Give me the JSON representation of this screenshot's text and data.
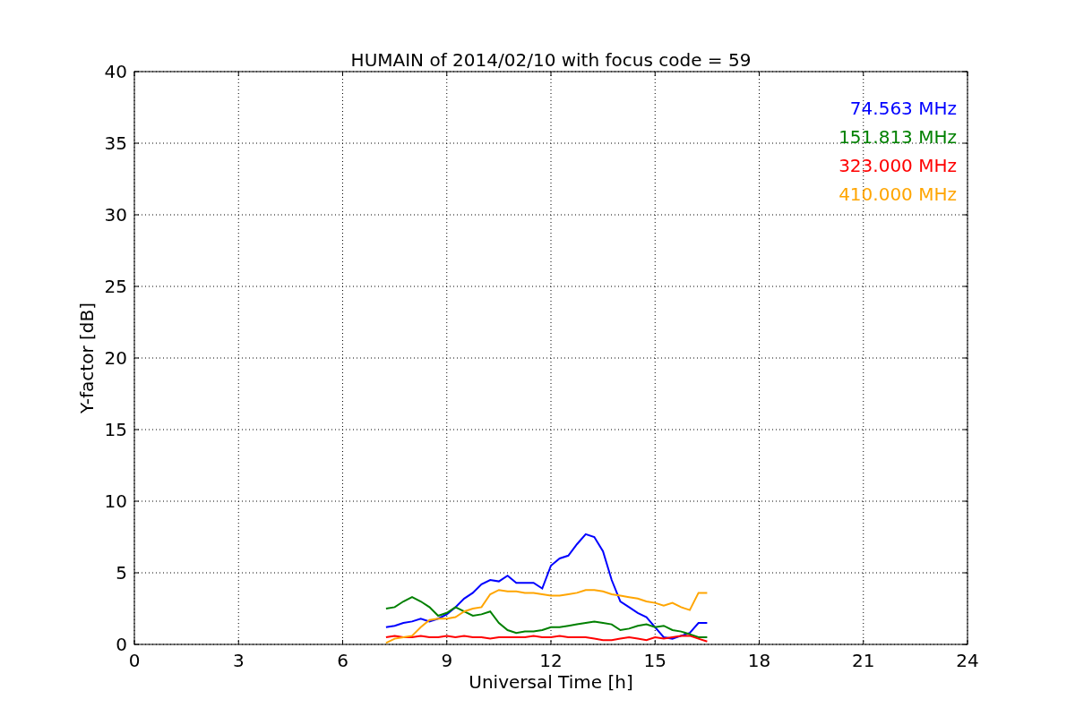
{
  "chart_data": {
    "type": "line",
    "title": "HUMAIN of 2014/02/10 with focus code = 59",
    "xlabel": "Universal Time [h]",
    "ylabel": "Y-factor [dB]",
    "x": [
      7.25,
      7.5,
      7.75,
      8,
      8.25,
      8.5,
      8.75,
      9,
      9.25,
      9.5,
      9.75,
      10,
      10.25,
      10.5,
      10.75,
      11,
      11.25,
      11.5,
      11.75,
      12,
      12.25,
      12.5,
      12.75,
      13,
      13.25,
      13.5,
      13.75,
      14,
      14.25,
      14.5,
      14.75,
      15,
      15.25,
      15.5,
      15.75,
      16,
      16.25,
      16.5
    ],
    "series": [
      {
        "name": "74.563 MHz",
        "color": "#0000ff",
        "values": [
          1.2,
          1.3,
          1.5,
          1.6,
          1.8,
          1.6,
          1.8,
          2.1,
          2.6,
          3.2,
          3.6,
          4.2,
          4.5,
          4.4,
          4.8,
          4.3,
          4.3,
          4.3,
          3.9,
          5.5,
          6.0,
          6.2,
          7.0,
          7.7,
          7.5,
          6.5,
          4.5,
          3.0,
          2.6,
          2.2,
          1.9,
          1.2,
          0.5,
          0.4,
          0.6,
          0.8,
          1.5,
          1.5
        ]
      },
      {
        "name": "151.813 MHz",
        "color": "#008000",
        "values": [
          2.5,
          2.6,
          3.0,
          3.3,
          3.0,
          2.6,
          2.0,
          2.2,
          2.6,
          2.3,
          2.0,
          2.1,
          2.3,
          1.5,
          1.0,
          0.8,
          0.9,
          0.9,
          1.0,
          1.2,
          1.2,
          1.3,
          1.4,
          1.5,
          1.6,
          1.5,
          1.4,
          1.0,
          1.1,
          1.3,
          1.4,
          1.2,
          1.3,
          1.0,
          0.9,
          0.7,
          0.5,
          0.5
        ]
      },
      {
        "name": "323.000 MHz",
        "color": "#ff0000",
        "values": [
          0.5,
          0.6,
          0.5,
          0.5,
          0.6,
          0.5,
          0.5,
          0.6,
          0.5,
          0.6,
          0.5,
          0.5,
          0.4,
          0.5,
          0.5,
          0.5,
          0.5,
          0.6,
          0.5,
          0.5,
          0.6,
          0.5,
          0.5,
          0.5,
          0.4,
          0.3,
          0.3,
          0.4,
          0.5,
          0.4,
          0.3,
          0.5,
          0.4,
          0.5,
          0.6,
          0.6,
          0.4,
          0.2
        ]
      },
      {
        "name": "410.000 MHz",
        "color": "#ffa500",
        "values": [
          0.1,
          0.4,
          0.5,
          0.6,
          1.2,
          1.7,
          1.8,
          1.8,
          1.9,
          2.3,
          2.5,
          2.6,
          3.5,
          3.8,
          3.7,
          3.7,
          3.6,
          3.6,
          3.5,
          3.4,
          3.4,
          3.5,
          3.6,
          3.8,
          3.8,
          3.7,
          3.5,
          3.4,
          3.3,
          3.2,
          3.0,
          2.9,
          2.7,
          2.9,
          2.6,
          2.4,
          3.6,
          3.6
        ]
      }
    ],
    "grid": true,
    "xlim": [
      0,
      24
    ],
    "ylim": [
      0,
      40
    ],
    "xticks": [
      0,
      3,
      6,
      9,
      12,
      15,
      18,
      21,
      24
    ],
    "yticks": [
      0,
      5,
      10,
      15,
      20,
      25,
      30,
      35,
      40
    ]
  }
}
